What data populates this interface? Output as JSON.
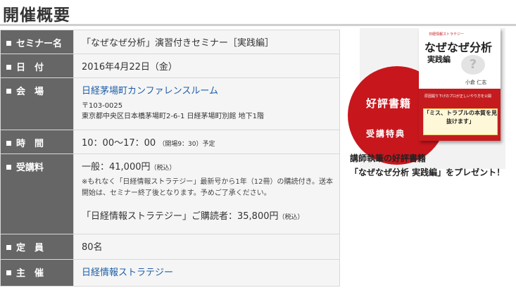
{
  "heading": "開催概要",
  "rows": {
    "seminar": {
      "label": "セミナー名",
      "value": "「なぜなぜ分析」演習付きセミナー［実践編］"
    },
    "date": {
      "label": "日　付",
      "value": "2016年4月22日（金）"
    },
    "venue": {
      "label": "会　場",
      "name": "日経茅場町カンファレンスルーム",
      "postal": "〒103-0025",
      "address": "東京都中央区日本橋茅場町2-6-1 日経茅場町別館 地下1階"
    },
    "time": {
      "label": "時　間",
      "value": "10：00〜17：00",
      "note": "（開場9：30）予定"
    },
    "fee": {
      "label": "受講料",
      "general": "一般：41,000円",
      "general_tax": "（税込）",
      "note": "※もれなく「日経情報ストラテジー」最新号から1年（12冊）の購読付き。送本開始は、セミナー終了後となります。予めご了承ください。",
      "reader": "「日経情報ストラテジー」ご購読者：35,800円",
      "reader_tax": "（税込）"
    },
    "capacity": {
      "label": "定　員",
      "value": "80名"
    },
    "organizer": {
      "label": "主　催",
      "value": "日経情報ストラテジー"
    }
  },
  "promo": {
    "circle_label": "好評書籍",
    "bonus_label": "受講特典",
    "book_series": "日経情報ストラテジー",
    "book_title": "なぜなぜ分析",
    "book_subtitle": "実践編",
    "book_author": "小倉 仁志",
    "book_blurb": "原因掘り下げのプロが正しいやり方を公開",
    "book_catch": "「ミス、トラブルの本質を見抜けます」",
    "caption_line1": "講師執筆の好評書籍",
    "caption_line2": "「なぜなぜ分析 実践編」をプレゼント！"
  },
  "colors": {
    "label_bg": "#666666",
    "value_bg": "#f5f5f5",
    "link": "#1f5fa8",
    "accent_red": "#c8161d"
  }
}
